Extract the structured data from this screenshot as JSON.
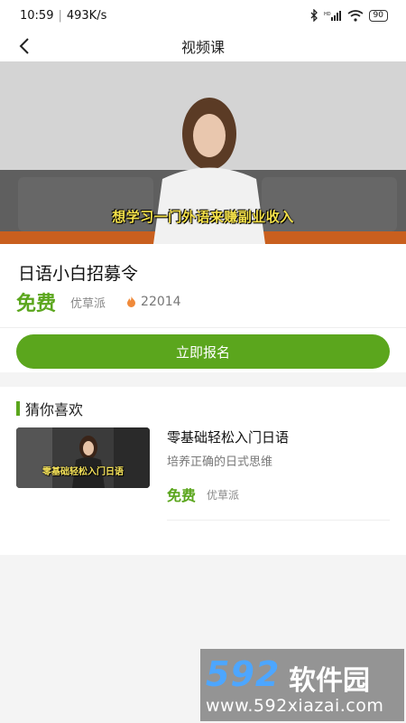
{
  "status": {
    "time": "10:59",
    "speed": "493K/s",
    "battery": "90"
  },
  "nav": {
    "title": "视频课"
  },
  "video": {
    "caption": "想学习一门外语来赚副业收入"
  },
  "course": {
    "title": "日语小白招募令",
    "price": "免费",
    "provider": "优草派",
    "views": "22014"
  },
  "enroll": {
    "label": "立即报名"
  },
  "recommend": {
    "title": "猜你喜欢",
    "items": [
      {
        "thumb_caption": "零基础轻松入门日语",
        "title": "零基础轻松入门日语",
        "subtitle": "培养正确的日式思维",
        "price": "免费",
        "provider": "优草派"
      }
    ]
  },
  "watermark": {
    "logo": "592",
    "name": "软件园",
    "url": "www.592xiazai.com"
  },
  "colors": {
    "accent": "#5ba61d",
    "caption": "#f4e14a"
  }
}
